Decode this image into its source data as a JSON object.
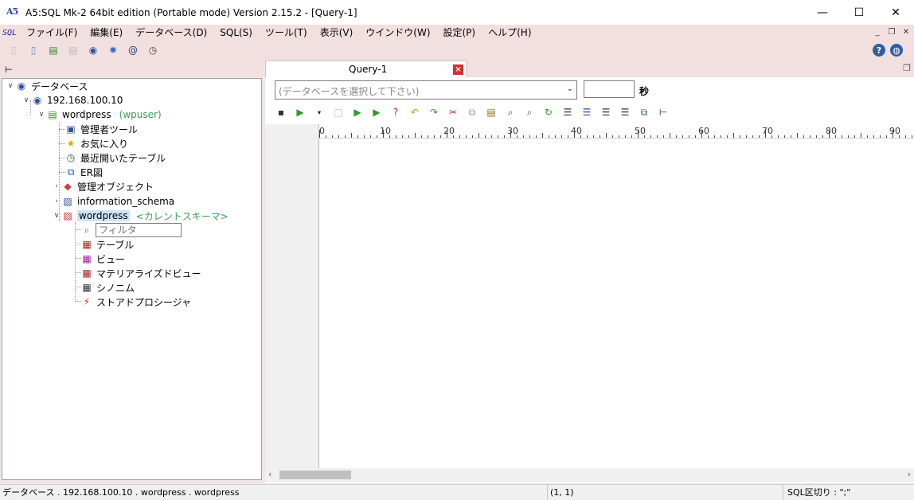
{
  "window": {
    "title": "A5:SQL Mk-2 64bit edition (Portable mode) Version 2.15.2 - [Query-1]",
    "icon_text": "A5"
  },
  "menu": {
    "sql_icon_text": "SQL",
    "items": [
      {
        "label": "ファイル(F)"
      },
      {
        "label": "編集(E)"
      },
      {
        "label": "データベース(D)"
      },
      {
        "label": "SQL(S)"
      },
      {
        "label": "ツール(T)"
      },
      {
        "label": "表示(V)"
      },
      {
        "label": "ウインドウ(W)"
      },
      {
        "label": "設定(P)"
      },
      {
        "label": "ヘルプ(H)"
      }
    ]
  },
  "tree": {
    "root": "データベース",
    "host": "192.168.100.10",
    "db": "wordpress",
    "db_user": "(wpuser)",
    "admin_tools": "管理者ツール",
    "favorites": "お気に入り",
    "recent_tables": "最近開いたテーブル",
    "er": "ER図",
    "admin_objects": "管理オブジェクト",
    "info_schema": "information_schema",
    "schema": "wordpress",
    "schema_note": "<カレントスキーマ>",
    "filter_placeholder": "フィルタ",
    "tables": "テーブル",
    "views": "ビュー",
    "mviews": "マテリアライズドビュー",
    "synonyms": "シノニム",
    "procs": "ストアドプロシージャ"
  },
  "tab": {
    "label": "Query-1",
    "close": "×"
  },
  "query": {
    "db_select_placeholder": "(データベースを選択して下さい)",
    "timeout_value": "",
    "timeout_unit": "秒"
  },
  "ruler": {
    "labels": [
      "0",
      "10",
      "20",
      "30",
      "40",
      "50",
      "60",
      "70",
      "80",
      "90"
    ]
  },
  "status": {
    "path": "データベース . 192.168.100.10 . wordpress . wordpress",
    "cursor": "(1, 1)",
    "delimiter": "SQL区切り : \";\""
  },
  "colors": {
    "chrome": "#f2dfe0",
    "selection": "#cce4f7",
    "schema_note": "#3a9a5a"
  }
}
